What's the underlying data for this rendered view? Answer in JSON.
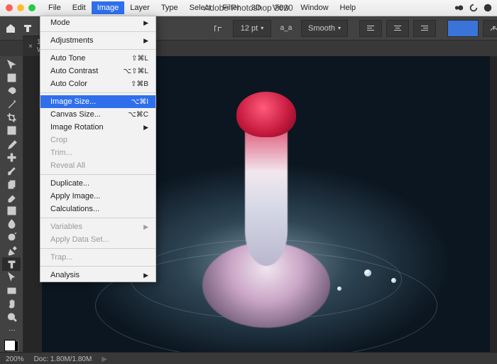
{
  "title": "Adobe Photoshop 2020",
  "menubar": [
    "File",
    "Edit",
    "Image",
    "Layer",
    "Type",
    "Select",
    "Filter",
    "3D",
    "View",
    "Window",
    "Help"
  ],
  "menubar_active_index": 2,
  "dropdown": {
    "groups": [
      [
        {
          "label": "Mode",
          "submenu": true
        }
      ],
      [
        {
          "label": "Adjustments",
          "submenu": true
        }
      ],
      [
        {
          "label": "Auto Tone",
          "shortcut": "⇧⌘L"
        },
        {
          "label": "Auto Contrast",
          "shortcut": "⌥⇧⌘L"
        },
        {
          "label": "Auto Color",
          "shortcut": "⇧⌘B"
        }
      ],
      [
        {
          "label": "Image Size...",
          "shortcut": "⌥⌘I",
          "highlight": true
        },
        {
          "label": "Canvas Size...",
          "shortcut": "⌥⌘C"
        },
        {
          "label": "Image Rotation",
          "submenu": true
        },
        {
          "label": "Crop",
          "disabled": true
        },
        {
          "label": "Trim...",
          "disabled": true
        },
        {
          "label": "Reveal All",
          "disabled": true
        }
      ],
      [
        {
          "label": "Duplicate..."
        },
        {
          "label": "Apply Image..."
        },
        {
          "label": "Calculations..."
        }
      ],
      [
        {
          "label": "Variables",
          "submenu": true,
          "disabled": true
        },
        {
          "label": "Apply Data Set...",
          "disabled": true
        }
      ],
      [
        {
          "label": "Trap...",
          "disabled": true
        }
      ],
      [
        {
          "label": "Analysis",
          "submenu": true
        }
      ]
    ]
  },
  "options": {
    "font_size_value": "12 pt",
    "aa_label": "a_a",
    "smooth": "Smooth"
  },
  "tab": {
    "label": "1-W…",
    "close": "×"
  },
  "status": {
    "zoom": "200%",
    "doc": "Doc: 1.80M/1.80M",
    "arrow": "▶"
  }
}
